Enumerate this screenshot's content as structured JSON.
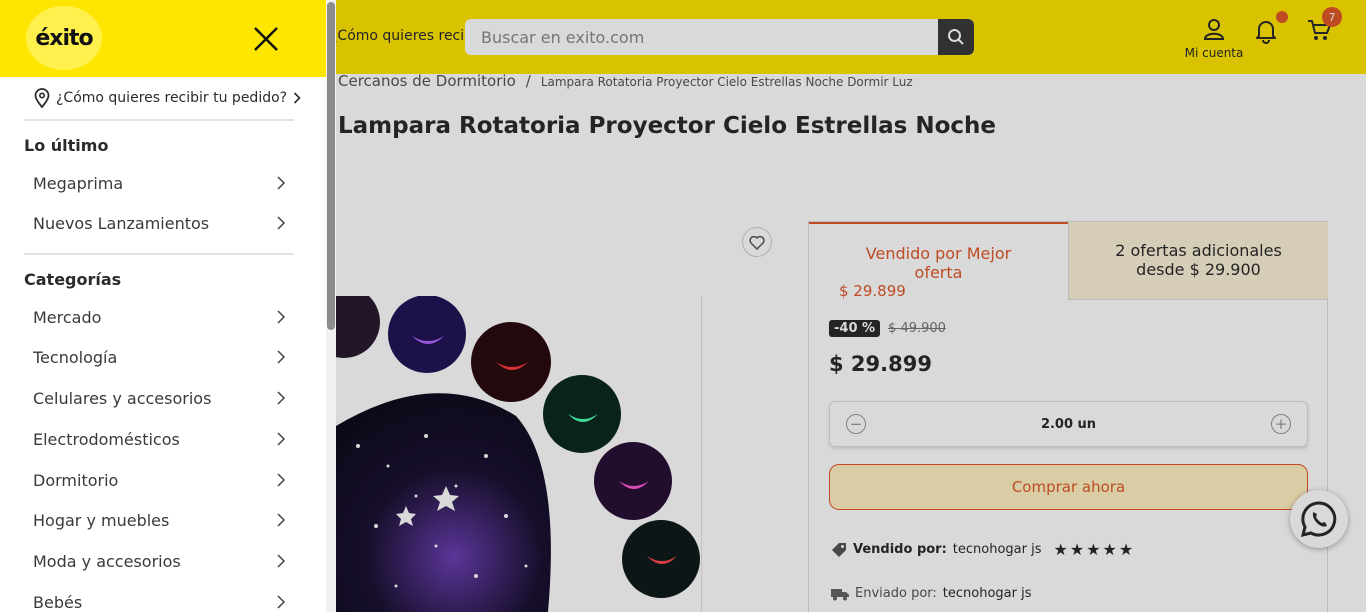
{
  "header": {
    "delivery_text": "¿Cómo quieres recibir tu pedido?",
    "search_placeholder": "Buscar en exito.com",
    "account_label": "Mi cuenta",
    "cart_count": "7"
  },
  "breadcrumb": {
    "category": "Cercanos de Dormitorio",
    "separator": "/",
    "current": "Lampara Rotatoria Proyector Cielo Estrellas Noche Dormir Luz"
  },
  "product": {
    "title": "Lampara Rotatoria Proyector Cielo Estrellas Noche"
  },
  "offers": {
    "tab_main_label": "Vendido por Mejor oferta",
    "tab_main_price": "$ 29.899",
    "tab_other_label": "2 ofertas adicionales desde $ 29.900",
    "discount": "-40 %",
    "old_price": "$ 49.900",
    "price": "$ 29.899",
    "quantity": "2.00 un",
    "buy_label": "Comprar ahora",
    "sold_by_label": "Vendido por:",
    "sold_by_value": "tecnohogar js",
    "rating_stars": 5,
    "shipped_by_label": "Enviado por:",
    "shipped_by_value": "tecnohogar js"
  },
  "drawer": {
    "logo_text": "éxito",
    "delivery_text": "¿Cómo quieres recibir tu pedido?",
    "section_latest": "Lo último",
    "latest_items": [
      "Megaprima",
      "Nuevos Lanzamientos"
    ],
    "section_categories": "Categorías",
    "category_items": [
      "Mercado",
      "Tecnología",
      "Celulares y accesorios",
      "Electrodomésticos",
      "Dormitorio",
      "Hogar y muebles",
      "Moda y accesorios",
      "Bebés"
    ]
  },
  "colors": {
    "brand_yellow": "#ffe600",
    "accent_orange": "#e0592a"
  },
  "icons": [
    "close-icon",
    "location-pin-icon",
    "chevron-right-icon",
    "search-icon",
    "user-icon",
    "bell-icon",
    "cart-icon",
    "heart-icon",
    "tag-icon",
    "truck-icon",
    "whatsapp-icon",
    "minus-icon",
    "plus-icon",
    "star-icon"
  ]
}
